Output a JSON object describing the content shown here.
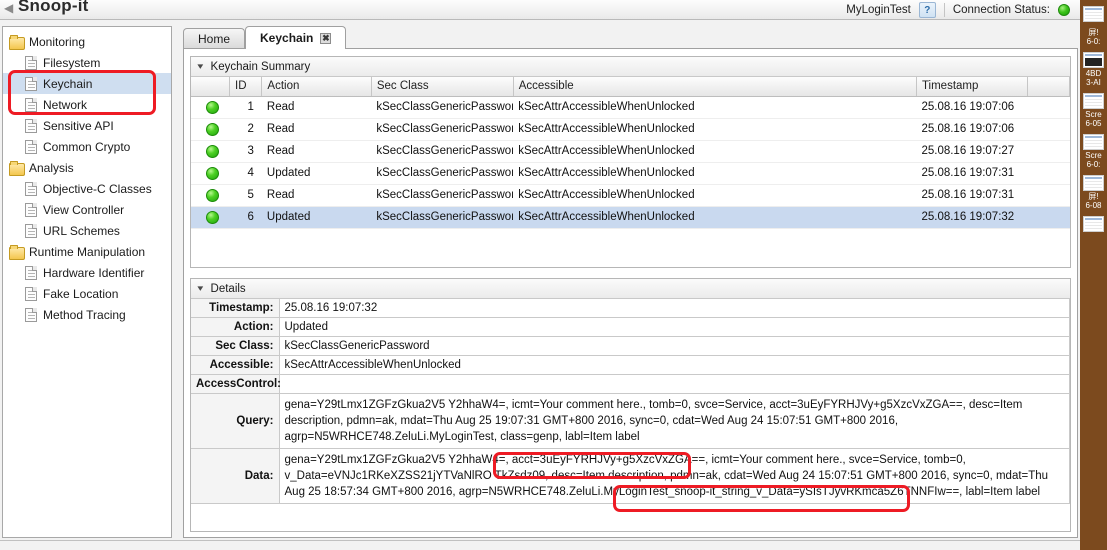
{
  "window": {
    "app_title": "Snoop-it",
    "back_arrow_icon": "chevron-left-icon"
  },
  "header": {
    "login_label": "MyLoginTest",
    "help_label": "?",
    "connection_label": "Connection Status:",
    "connection_state": "connected",
    "connection_color": "#2ea80c"
  },
  "sidebar": {
    "groups": [
      {
        "label": "Monitoring",
        "icon": "folder-icon",
        "items": [
          {
            "label": "Filesystem",
            "icon": "file-icon",
            "selected": false
          },
          {
            "label": "Keychain",
            "icon": "file-icon",
            "selected": true
          },
          {
            "label": "Network",
            "icon": "file-icon",
            "selected": false
          },
          {
            "label": "Sensitive API",
            "icon": "file-icon",
            "selected": false
          },
          {
            "label": "Common Crypto",
            "icon": "file-icon",
            "selected": false
          }
        ]
      },
      {
        "label": "Analysis",
        "icon": "folder-icon",
        "items": [
          {
            "label": "Objective-C Classes",
            "icon": "file-icon",
            "selected": false
          },
          {
            "label": "View Controller",
            "icon": "file-icon",
            "selected": false
          },
          {
            "label": "URL Schemes",
            "icon": "file-icon",
            "selected": false
          }
        ]
      },
      {
        "label": "Runtime Manipulation",
        "icon": "folder-icon",
        "items": [
          {
            "label": "Hardware Identifier",
            "icon": "file-icon",
            "selected": false
          },
          {
            "label": "Fake Location",
            "icon": "file-icon",
            "selected": false
          },
          {
            "label": "Method Tracing",
            "icon": "file-icon",
            "selected": false
          }
        ]
      }
    ]
  },
  "tabs": [
    {
      "label": "Home",
      "active": false,
      "closable": false
    },
    {
      "label": "Keychain",
      "active": true,
      "closable": true,
      "close_icon": "close-icon"
    }
  ],
  "summary": {
    "title": "Keychain Summary",
    "collapse_icon": "chevron-down-icon",
    "columns": [
      "",
      "ID",
      "Action",
      "Sec Class",
      "Accessible",
      "Timestamp",
      ""
    ],
    "rows": [
      {
        "status": "ok",
        "id": "1",
        "action": "Read",
        "sec_class": "kSecClassGenericPassword",
        "accessible": "kSecAttrAccessibleWhenUnlocked",
        "timestamp": "25.08.16 19:07:06",
        "selected": false
      },
      {
        "status": "ok",
        "id": "2",
        "action": "Read",
        "sec_class": "kSecClassGenericPassword",
        "accessible": "kSecAttrAccessibleWhenUnlocked",
        "timestamp": "25.08.16 19:07:06",
        "selected": false
      },
      {
        "status": "ok",
        "id": "3",
        "action": "Read",
        "sec_class": "kSecClassGenericPassword",
        "accessible": "kSecAttrAccessibleWhenUnlocked",
        "timestamp": "25.08.16 19:07:27",
        "selected": false
      },
      {
        "status": "ok",
        "id": "4",
        "action": "Updated",
        "sec_class": "kSecClassGenericPassword",
        "accessible": "kSecAttrAccessibleWhenUnlocked",
        "timestamp": "25.08.16 19:07:31",
        "selected": false
      },
      {
        "status": "ok",
        "id": "5",
        "action": "Read",
        "sec_class": "kSecClassGenericPassword",
        "accessible": "kSecAttrAccessibleWhenUnlocked",
        "timestamp": "25.08.16 19:07:31",
        "selected": false
      },
      {
        "status": "ok",
        "id": "6",
        "action": "Updated",
        "sec_class": "kSecClassGenericPassword",
        "accessible": "kSecAttrAccessibleWhenUnlocked",
        "timestamp": "25.08.16 19:07:32",
        "selected": true
      }
    ]
  },
  "details": {
    "title": "Details",
    "collapse_icon": "chevron-down-icon",
    "fields": {
      "timestamp_label": "Timestamp:",
      "timestamp_value": "25.08.16 19:07:32",
      "action_label": "Action:",
      "action_value": "Updated",
      "sec_class_label": "Sec Class:",
      "sec_class_value": "kSecClassGenericPassword",
      "accessible_label": "Accessible:",
      "accessible_value": "kSecAttrAccessibleWhenUnlocked",
      "access_control_label": "AccessControl:",
      "access_control_value": "",
      "query_label": "Query:",
      "query_value": "gena=Y29tLmx1ZGFzGkua2V5 Y2hhaW4=, icmt=Your comment here., tomb=0, svce=Service, acct=3uEyFYRHJVy+g5XzcVxZGA==, desc=Item description, pdmn=ak, mdat=Thu Aug 25 19:07:31 GMT+800 2016, sync=0, cdat=Wed Aug 24 15:07:51 GMT+800 2016, agrp=N5WRHCE748.ZeluLi.MyLoginTest, class=genp, labl=Item label",
      "data_label": "Data:",
      "data_value": "gena=Y29tLmx1ZGFzGkua2V5 Y2hhaW4=, acct=3uEyFYRHJVy+g5XzcVxZGA==, icmt=Your comment here., svce=Service, tomb=0, v_Data=eVNJc1RKeXZSS21jYTVaNlRO TkZsdz09, desc=Item description, pdmn=ak, cdat=Wed Aug 24 15:07:51 GMT+800 2016, sync=0, mdat=Thu Aug 25 18:57:34 GMT+800 2016, agrp=N5WRHCE748.ZeluLi.MyLoginTest_snoop-it_string_v_Data=ySIsTJyvRKmca5Z6TNNFIw==, labl=Item label"
    }
  },
  "annotations": {
    "box_color": "#ee1b24",
    "boxes": [
      {
        "name": "sidebar-highlight",
        "note": "Keychain and Network sidebar entries"
      },
      {
        "name": "data-acct-highlight",
        "note": "acct=3uEyFYRHJVy+g5XzcVxZGA=="
      },
      {
        "name": "data-snoopit-highlight",
        "note": "_snoop-it_string_v_Data=ySIsTJyvRKmca5Z6TNNFIw=="
      }
    ]
  },
  "desktop_strip": {
    "items": [
      {
        "label": ""
      },
      {
        "label": "屏!"
      },
      {
        "label": "6-0:"
      },
      {
        "label": ""
      },
      {
        "label": "4BD"
      },
      {
        "label": "3-AI"
      },
      {
        "label": ""
      },
      {
        "label": "Scre"
      },
      {
        "label": "6-05"
      },
      {
        "label": ""
      },
      {
        "label": "Scre"
      },
      {
        "label": "6-0:"
      },
      {
        "label": ""
      },
      {
        "label": "屏!"
      },
      {
        "label": "6-08"
      }
    ]
  }
}
